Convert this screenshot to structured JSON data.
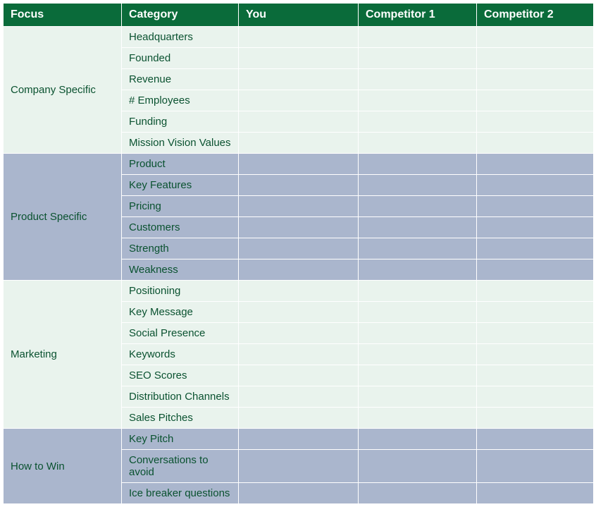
{
  "headers": {
    "focus": "Focus",
    "category": "Category",
    "you": "You",
    "comp1": "Competitor 1",
    "comp2": "Competitor 2"
  },
  "sections": [
    {
      "focus": "Company Specific",
      "style": "light",
      "rows": [
        {
          "category": "Headquarters",
          "you": "",
          "comp1": "",
          "comp2": ""
        },
        {
          "category": "Founded",
          "you": "",
          "comp1": "",
          "comp2": ""
        },
        {
          "category": "Revenue",
          "you": "",
          "comp1": "",
          "comp2": ""
        },
        {
          "category": "# Employees",
          "you": "",
          "comp1": "",
          "comp2": ""
        },
        {
          "category": "Funding",
          "you": "",
          "comp1": "",
          "comp2": ""
        },
        {
          "category": "Mission Vision Values",
          "you": "",
          "comp1": "",
          "comp2": ""
        }
      ]
    },
    {
      "focus": "Product Specific",
      "style": "dark",
      "rows": [
        {
          "category": "Product",
          "you": "",
          "comp1": "",
          "comp2": ""
        },
        {
          "category": "Key Features",
          "you": "",
          "comp1": "",
          "comp2": ""
        },
        {
          "category": "Pricing",
          "you": "",
          "comp1": "",
          "comp2": ""
        },
        {
          "category": "Customers",
          "you": "",
          "comp1": "",
          "comp2": ""
        },
        {
          "category": "Strength",
          "you": "",
          "comp1": "",
          "comp2": ""
        },
        {
          "category": "Weakness",
          "you": "",
          "comp1": "",
          "comp2": ""
        }
      ]
    },
    {
      "focus": "Marketing",
      "style": "light",
      "rows": [
        {
          "category": "Positioning",
          "you": "",
          "comp1": "",
          "comp2": ""
        },
        {
          "category": "Key Message",
          "you": "",
          "comp1": "",
          "comp2": ""
        },
        {
          "category": "Social Presence",
          "you": "",
          "comp1": "",
          "comp2": ""
        },
        {
          "category": "Keywords",
          "you": "",
          "comp1": "",
          "comp2": ""
        },
        {
          "category": "SEO Scores",
          "you": "",
          "comp1": "",
          "comp2": ""
        },
        {
          "category": "Distribution Channels",
          "you": "",
          "comp1": "",
          "comp2": ""
        },
        {
          "category": "Sales Pitches",
          "you": "",
          "comp1": "",
          "comp2": ""
        }
      ]
    },
    {
      "focus": "How to Win",
      "style": "dark",
      "rows": [
        {
          "category": "Key Pitch",
          "you": "",
          "comp1": "",
          "comp2": ""
        },
        {
          "category": "Conversations to avoid",
          "you": "",
          "comp1": "",
          "comp2": ""
        },
        {
          "category": "Ice breaker questions",
          "you": "",
          "comp1": "",
          "comp2": ""
        }
      ]
    }
  ]
}
